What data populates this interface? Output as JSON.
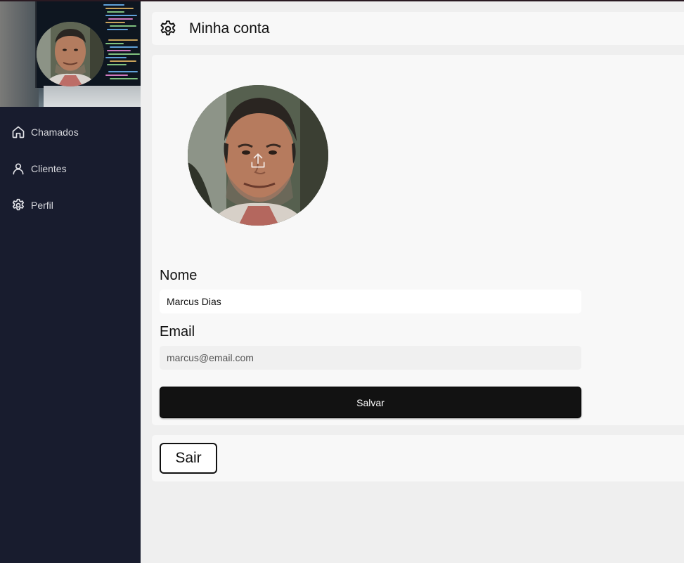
{
  "sidebar": {
    "items": [
      {
        "label": "Chamados",
        "icon": "home-icon"
      },
      {
        "label": "Clientes",
        "icon": "user-icon"
      },
      {
        "label": "Perfil",
        "icon": "gear-icon"
      }
    ]
  },
  "header": {
    "title": "Minha conta",
    "icon": "gear-icon"
  },
  "profile": {
    "avatar_action_icon": "upload-icon",
    "name_label": "Nome",
    "name_value": "Marcus Dias",
    "email_label": "Email",
    "email_value": "marcus@email.com",
    "save_label": "Salvar"
  },
  "logout": {
    "label": "Sair"
  },
  "colors": {
    "sidebar_bg": "#181c2e",
    "content_bg": "#efefef",
    "card_bg": "#f8f8f8",
    "button_dark": "#121212"
  }
}
